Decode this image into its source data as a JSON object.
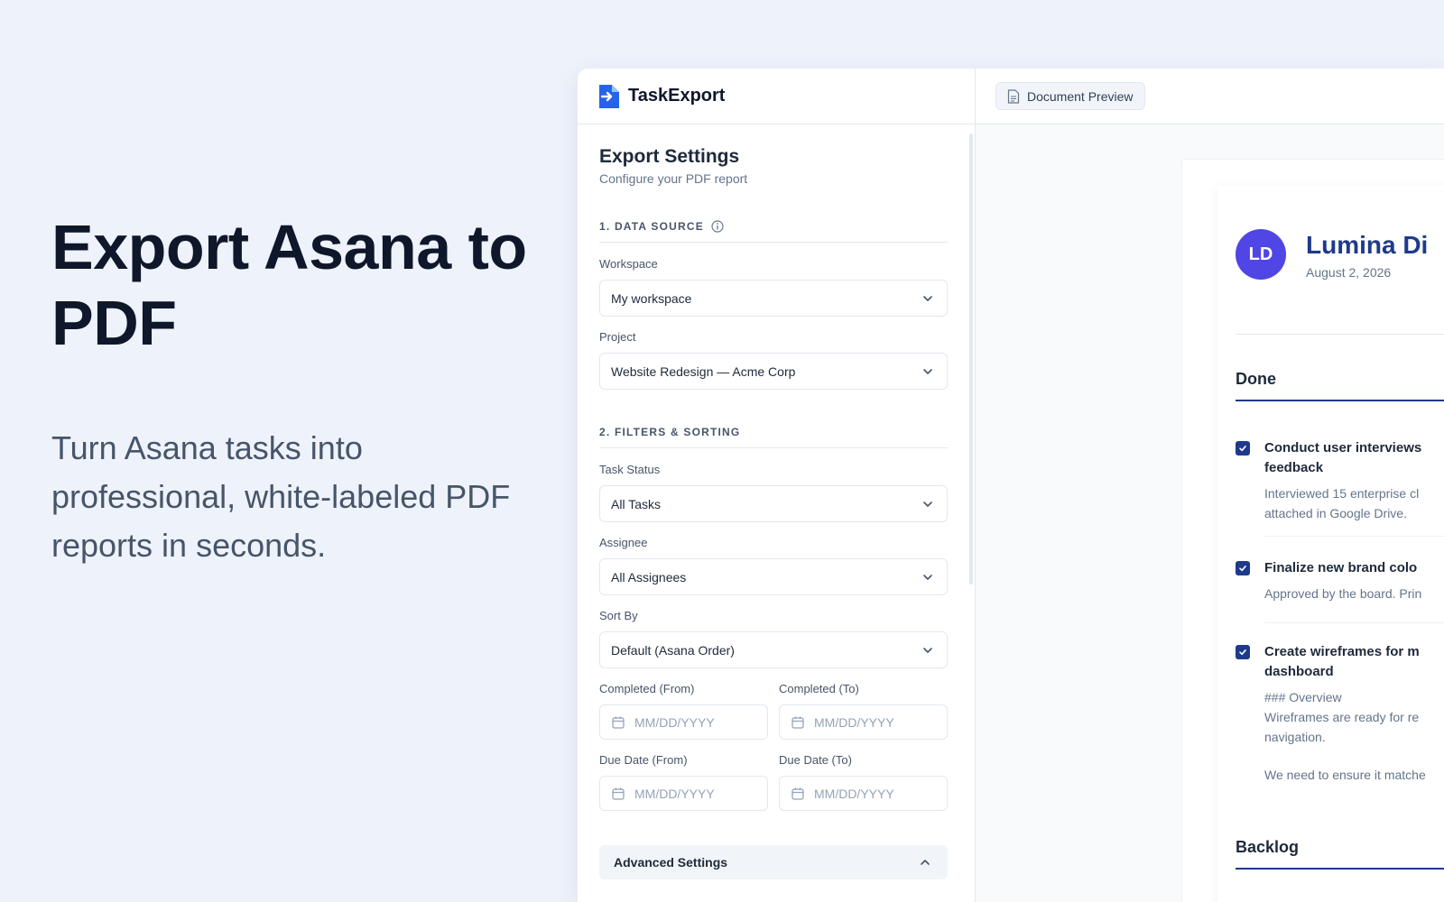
{
  "hero": {
    "title": "Export Asana to PDF",
    "subtitle": "Turn Asana tasks into professional, white-labeled PDF reports in seconds."
  },
  "app": {
    "brand": "TaskExport",
    "settings": {
      "title": "Export Settings",
      "subtitle": "Configure your PDF report",
      "sections": {
        "data_source": "1. DATA SOURCE",
        "filters": "2. FILTERS & SORTING"
      },
      "workspace": {
        "label": "Workspace",
        "value": "My workspace"
      },
      "project": {
        "label": "Project",
        "value": "Website Redesign — Acme Corp"
      },
      "task_status": {
        "label": "Task Status",
        "value": "All Tasks"
      },
      "assignee": {
        "label": "Assignee",
        "value": "All Assignees"
      },
      "sort_by": {
        "label": "Sort By",
        "value": "Default (Asana Order)"
      },
      "completed_from": {
        "label": "Completed (From)",
        "placeholder": "MM/DD/YYYY"
      },
      "completed_to": {
        "label": "Completed (To)",
        "placeholder": "MM/DD/YYYY"
      },
      "due_from": {
        "label": "Due Date (From)",
        "placeholder": "MM/DD/YYYY"
      },
      "due_to": {
        "label": "Due Date (To)",
        "placeholder": "MM/DD/YYYY"
      },
      "advanced": "Advanced Settings"
    },
    "preview": {
      "tab": "Document Preview",
      "avatar_initials": "LD",
      "company": "Lumina Di",
      "date": "August 2, 2026",
      "groups": {
        "done": "Done",
        "backlog": "Backlog"
      },
      "tasks": [
        {
          "title_line1": "Conduct user interviews",
          "title_line2": "feedback",
          "desc_line1": "Interviewed 15 enterprise cl",
          "desc_line2": "attached in Google Drive."
        },
        {
          "title_line1": "Finalize new brand colo",
          "desc_line1": "Approved by the board. Prin"
        },
        {
          "title_line1": "Create wireframes for m",
          "title_line2": "dashboard",
          "desc_line1": "### Overview",
          "desc_line2": "Wireframes are ready for re",
          "desc_line3": "navigation.",
          "desc_line4": "We need to ensure it matche"
        }
      ]
    }
  },
  "colors": {
    "background": "#eef2fb",
    "accent": "#1e3a8a",
    "avatar": "#4f46e5",
    "brand_logo": "#2563eb"
  },
  "icons": {
    "logo": "file-export-icon",
    "info": "info-icon",
    "chevron": "chevron-down-icon",
    "calendar": "calendar-icon",
    "document": "document-icon",
    "checkbox": "checkbox-checked-icon"
  }
}
